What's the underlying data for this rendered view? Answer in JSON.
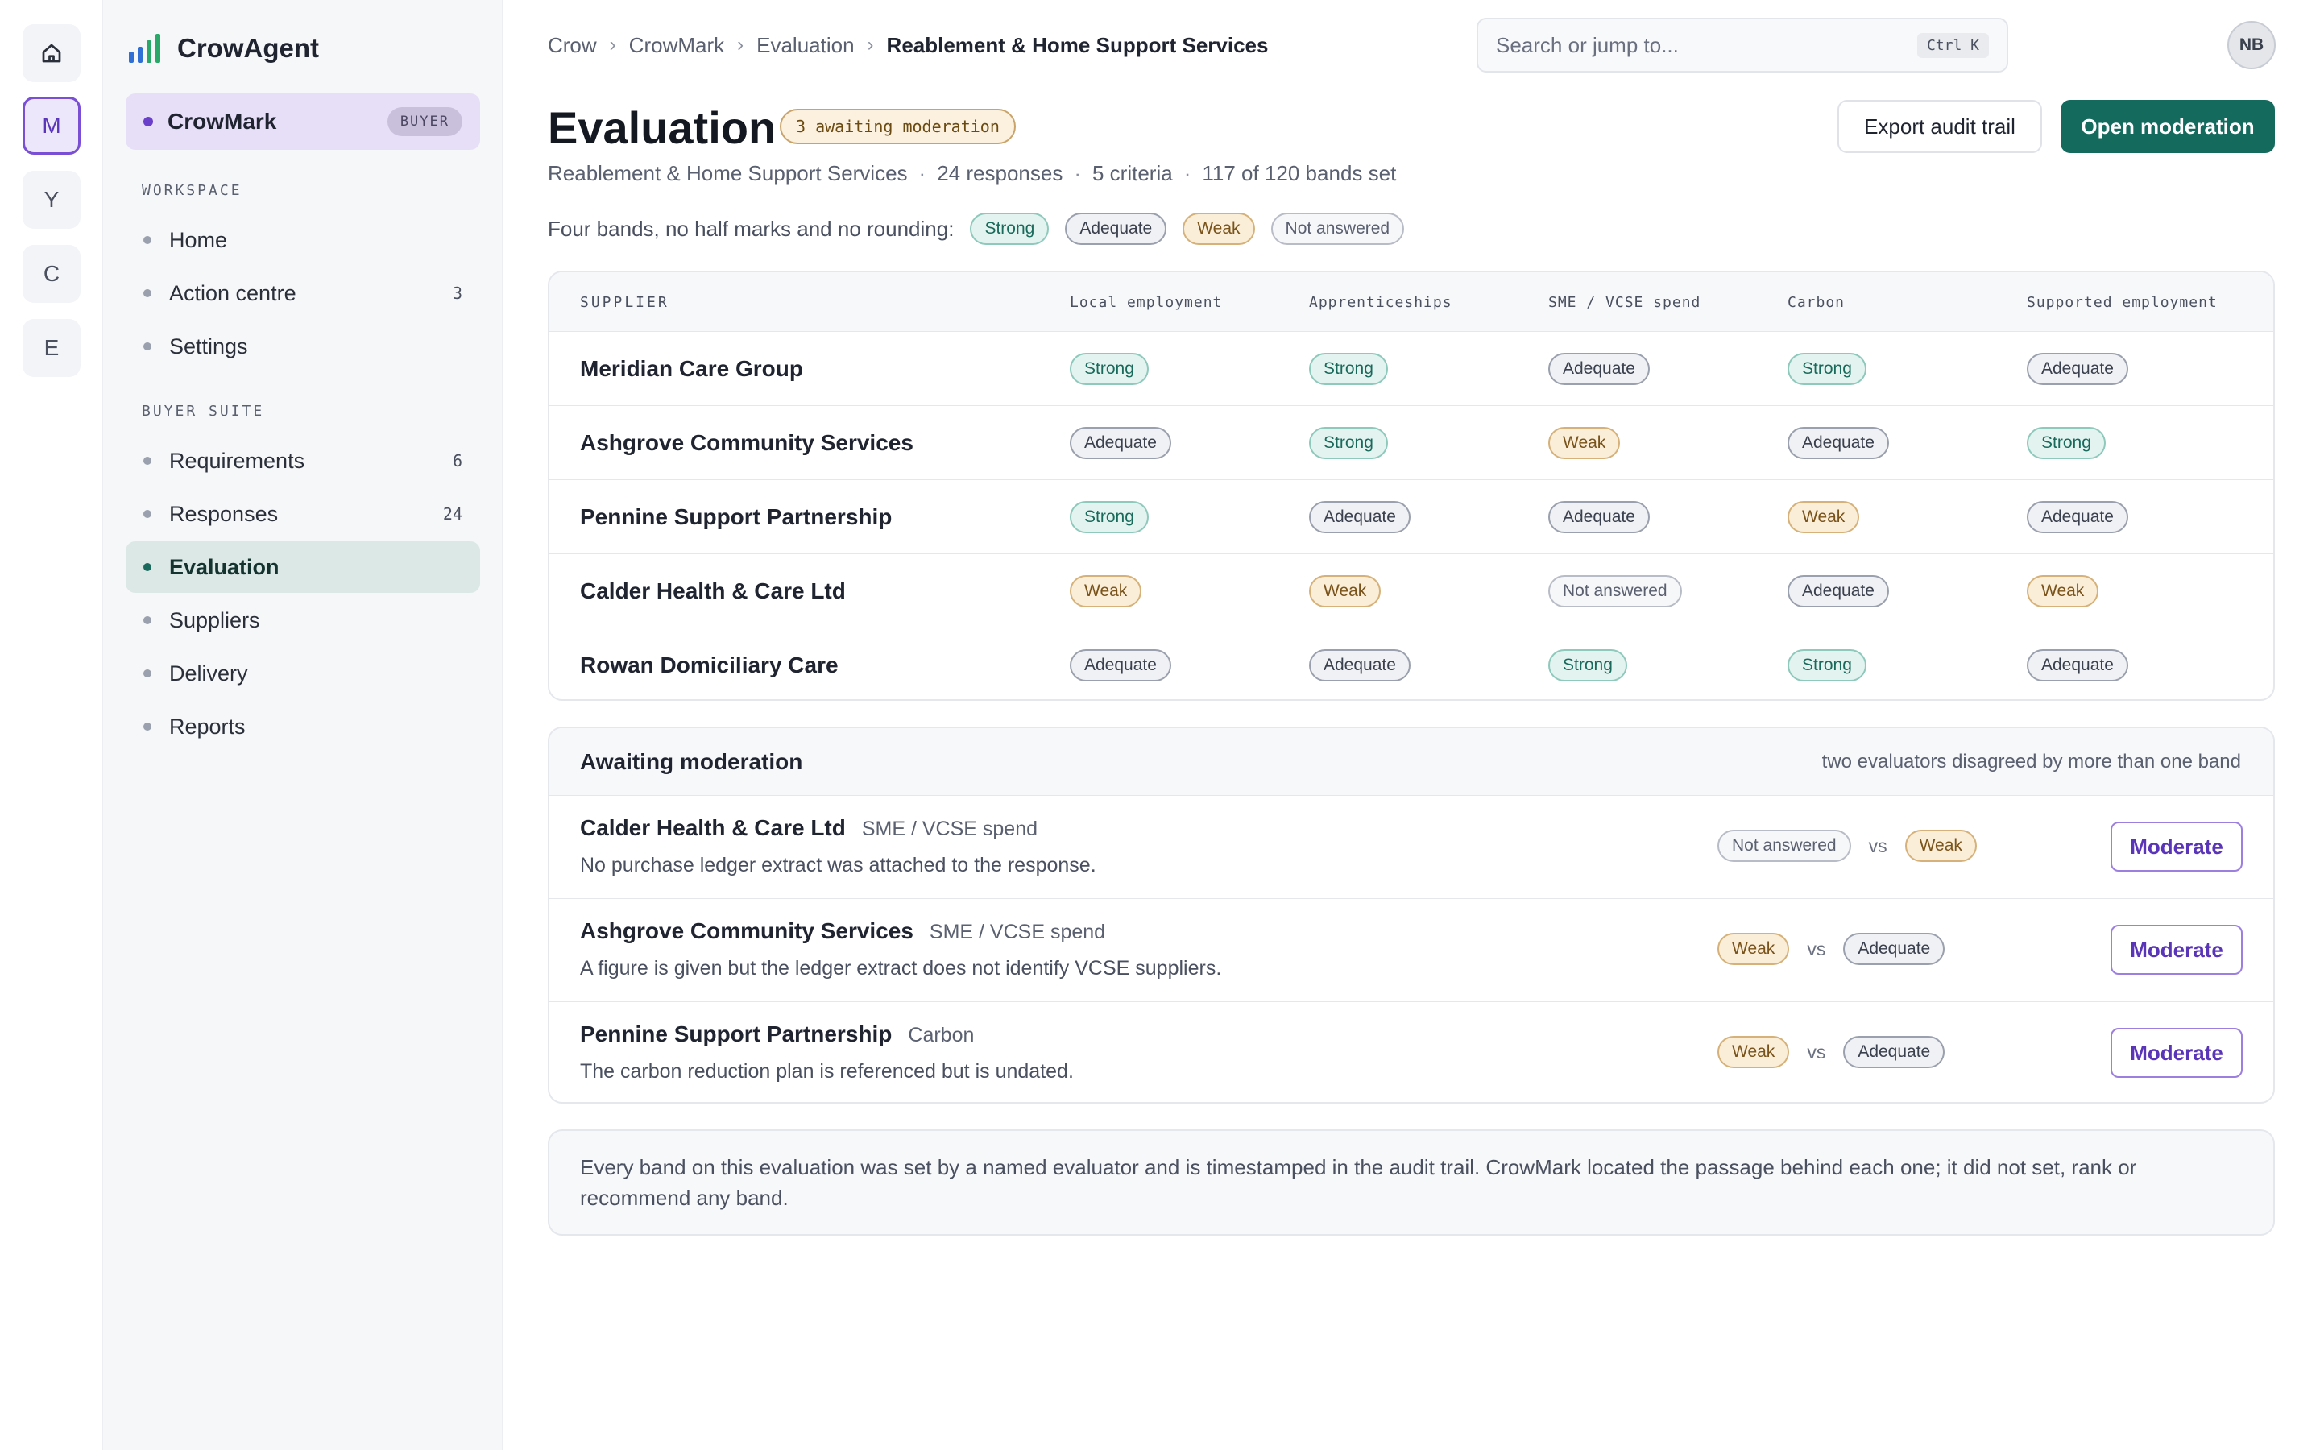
{
  "rail": {
    "items": [
      "M",
      "Y",
      "C",
      "E"
    ]
  },
  "brand": {
    "name": "CrowAgent"
  },
  "product": {
    "name": "CrowMark",
    "badge": "BUYER"
  },
  "sidebar": {
    "workspace_label": "WORKSPACE",
    "workspace_items": [
      {
        "label": "Home",
        "count": ""
      },
      {
        "label": "Action centre",
        "count": "3"
      },
      {
        "label": "Settings",
        "count": ""
      }
    ],
    "suite_label": "BUYER SUITE",
    "suite_items": [
      {
        "label": "Requirements",
        "count": "6"
      },
      {
        "label": "Responses",
        "count": "24"
      },
      {
        "label": "Evaluation",
        "count": ""
      },
      {
        "label": "Suppliers",
        "count": ""
      },
      {
        "label": "Delivery",
        "count": ""
      },
      {
        "label": "Reports",
        "count": ""
      }
    ],
    "active_item": "Evaluation"
  },
  "breadcrumb": [
    "Crow",
    "CrowMark",
    "Evaluation",
    "Reablement & Home Support Services"
  ],
  "search": {
    "placeholder": "Search or jump to...",
    "shortcut": "Ctrl K"
  },
  "user": {
    "initials": "NB"
  },
  "header": {
    "title": "Evaluation",
    "badge": "3 awaiting moderation",
    "export_label": "Export audit trail",
    "moderation_label": "Open moderation",
    "subtitle": [
      "Reablement & Home Support Services",
      "24 responses",
      "5 criteria",
      "117 of 120 bands set"
    ],
    "legend_text": "Four bands, no half marks and no rounding:",
    "legend_bands": [
      "Strong",
      "Adequate",
      "Weak",
      "Not answered"
    ]
  },
  "table": {
    "supplier_header": "SUPPLIER",
    "criteria": [
      "Local employment",
      "Apprenticeships",
      "SME / VCSE spend",
      "Carbon",
      "Supported employment"
    ],
    "rows": [
      {
        "supplier": "Meridian Care Group",
        "bands": [
          "Strong",
          "Strong",
          "Adequate",
          "Strong",
          "Adequate"
        ]
      },
      {
        "supplier": "Ashgrove Community Services",
        "bands": [
          "Adequate",
          "Strong",
          "Weak",
          "Adequate",
          "Strong"
        ]
      },
      {
        "supplier": "Pennine Support Partnership",
        "bands": [
          "Strong",
          "Adequate",
          "Adequate",
          "Weak",
          "Adequate"
        ]
      },
      {
        "supplier": "Calder Health & Care Ltd",
        "bands": [
          "Weak",
          "Weak",
          "Not answered",
          "Adequate",
          "Weak"
        ]
      },
      {
        "supplier": "Rowan Domiciliary Care",
        "bands": [
          "Adequate",
          "Adequate",
          "Strong",
          "Strong",
          "Adequate"
        ]
      }
    ]
  },
  "moderation": {
    "title": "Awaiting moderation",
    "note": "two evaluators disagreed by more than one band",
    "vs_label": "vs",
    "button_label": "Moderate",
    "items": [
      {
        "supplier": "Calder Health & Care Ltd",
        "criterion": "SME / VCSE spend",
        "description": "No purchase ledger extract was attached to the response.",
        "band_a": "Not answered",
        "band_b": "Weak"
      },
      {
        "supplier": "Ashgrove Community Services",
        "criterion": "SME / VCSE spend",
        "description": "A figure is given but the ledger extract does not identify VCSE suppliers.",
        "band_a": "Weak",
        "band_b": "Adequate"
      },
      {
        "supplier": "Pennine Support Partnership",
        "criterion": "Carbon",
        "description": "The carbon reduction plan is referenced but is undated.",
        "band_a": "Weak",
        "band_b": "Adequate"
      }
    ]
  },
  "footer_note": "Every band on this evaluation was set by a named evaluator and is timestamped in the audit trail. CrowMark located the passage behind each one; it did not set, rank or recommend any band.",
  "colors": {
    "accent_primary": "#136a5d",
    "accent_product": "#6a3fc9",
    "band_strong": "#1a6a5c",
    "band_adequate": "#3a404e",
    "band_weak": "#7a531a",
    "band_not_answered": "#5a6070"
  }
}
